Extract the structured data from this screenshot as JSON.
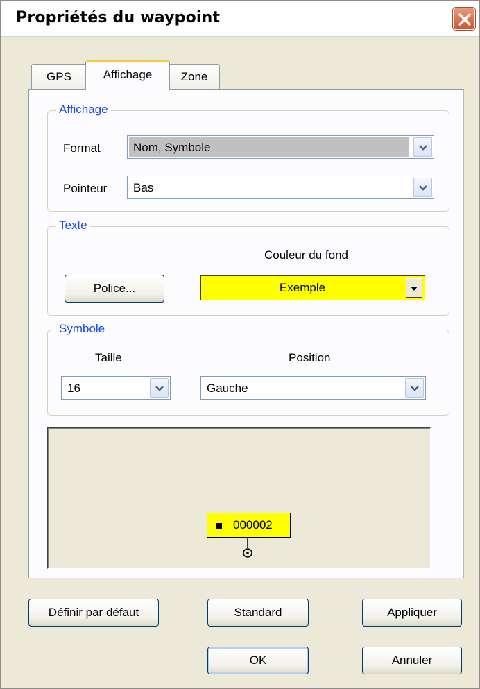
{
  "window": {
    "title": "Propriétés du waypoint"
  },
  "tabs": [
    {
      "label": "GPS"
    },
    {
      "label": "Affichage"
    },
    {
      "label": "Zone"
    }
  ],
  "affichage_group": {
    "legend": "Affichage",
    "format_label": "Format",
    "format_value": "Nom, Symbole",
    "pointeur_label": "Pointeur",
    "pointeur_value": "Bas"
  },
  "texte_group": {
    "legend": "Texte",
    "couleur_label": "Couleur du fond",
    "police_button": "Police...",
    "color_value": "Exemple",
    "color_hex": "#ffff00"
  },
  "symbole_group": {
    "legend": "Symbole",
    "taille_label": "Taille",
    "taille_value": "16",
    "position_label": "Position",
    "position_value": "Gauche"
  },
  "preview": {
    "waypoint_name": "000002"
  },
  "buttons": {
    "default": "Définir par défaut",
    "standard": "Standard",
    "apply": "Appliquer",
    "ok": "OK",
    "cancel": "Annuler"
  }
}
